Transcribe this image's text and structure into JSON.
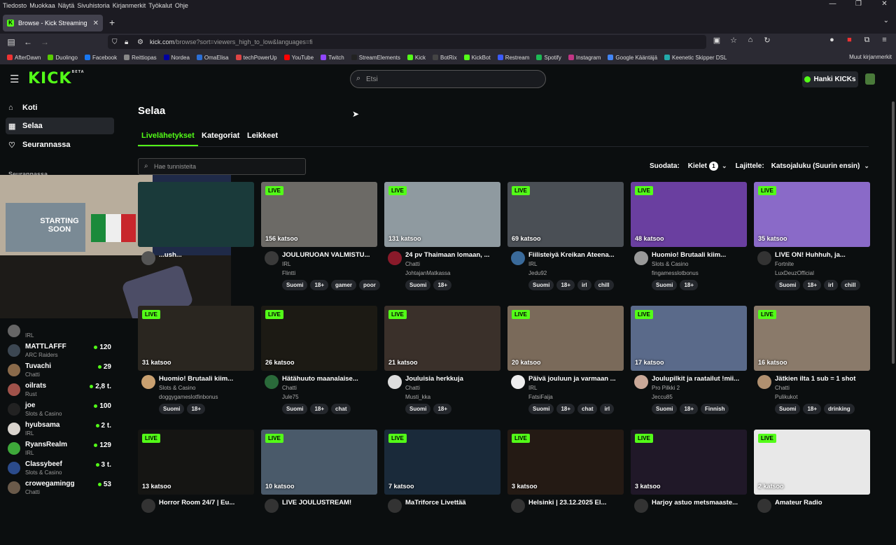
{
  "browser": {
    "menu": [
      "Tiedosto",
      "Muokkaa",
      "Näytä",
      "Sivuhistoria",
      "Kirjanmerkit",
      "Työkalut",
      "Ohje"
    ],
    "tab_title": "Browse - Kick Streaming",
    "url_domain": "kick.com",
    "url_path": "/browse?sort=viewers_high_to_low&languages=fi",
    "bookmarks": [
      {
        "label": "AfterDawn",
        "color": "#e33"
      },
      {
        "label": "Duolingo",
        "color": "#58cc02"
      },
      {
        "label": "Facebook",
        "color": "#1877f2"
      },
      {
        "label": "Reittiopas",
        "color": "#888"
      },
      {
        "label": "Nordea",
        "color": "#0000a0"
      },
      {
        "label": "OmaElisa",
        "color": "#2b6fd6"
      },
      {
        "label": "techPowerUp",
        "color": "#d44"
      },
      {
        "label": "YouTube",
        "color": "#f00"
      },
      {
        "label": "Twitch",
        "color": "#9146ff"
      },
      {
        "label": "StreamElements",
        "color": "#222"
      },
      {
        "label": "Kick",
        "color": "#53fc18"
      },
      {
        "label": "BotRix",
        "color": "#444"
      },
      {
        "label": "KickBot",
        "color": "#53fc18"
      },
      {
        "label": "Restream",
        "color": "#3b5bfd"
      },
      {
        "label": "Spotify",
        "color": "#1db954"
      },
      {
        "label": "Instagram",
        "color": "#c13584"
      },
      {
        "label": "Google Kääntäjä",
        "color": "#4285f4"
      },
      {
        "label": "Keenetic Skipper DSL",
        "color": "#2aa"
      }
    ],
    "other_bookmarks": "Muut kirjanmerkit"
  },
  "header": {
    "logo": "KICK",
    "logo_tag": "BETA",
    "search_placeholder": "Etsi",
    "kicks_button": "Hanki KICKs"
  },
  "sidebar": {
    "nav": [
      {
        "label": "Koti",
        "icon": "home-icon"
      },
      {
        "label": "Selaa",
        "icon": "browse-icon"
      },
      {
        "label": "Seurannassa",
        "icon": "heart-icon"
      }
    ],
    "following_title": "Seurannassa",
    "following": [
      {
        "name": "",
        "category": "IRL",
        "viewers": "",
        "color": "#666"
      },
      {
        "name": "MATTLAFFF",
        "category": "ARC Raiders",
        "viewers": "120",
        "color": "#3c4752"
      },
      {
        "name": "Tuvachi",
        "category": "Chatti",
        "viewers": "29",
        "color": "#8a6a4a"
      },
      {
        "name": "oilrats",
        "category": "Rust",
        "viewers": "2,8 t.",
        "color": "#a0524a"
      },
      {
        "name": "joe",
        "category": "Slots & Casino",
        "viewers": "100",
        "color": "#222"
      },
      {
        "name": "hyubsama",
        "category": "IRL",
        "viewers": "2 t.",
        "color": "#d9d4ce"
      },
      {
        "name": "RyansRealm",
        "category": "IRL",
        "viewers": "129",
        "color": "#3ea83a"
      },
      {
        "name": "Classybeef",
        "category": "Slots & Casino",
        "viewers": "3 t.",
        "color": "#2b4b8b"
      },
      {
        "name": "crowegamingg",
        "category": "Chatti",
        "viewers": "53",
        "color": "#6a5a4a"
      }
    ]
  },
  "webcam": {
    "poster_text": "STARTING SOON"
  },
  "main": {
    "title": "Selaa",
    "tabs": [
      "Livelähetykset",
      "Kategoriat",
      "Leikkeet"
    ],
    "tag_search_placeholder": "Hae tunnisteita",
    "filter_label": "Suodata:",
    "languages_label": "Kielet",
    "languages_count": "1",
    "sort_label": "Lajittele:",
    "sort_value": "Katsojaluku (Suurin ensin)",
    "live_label": "LIVE",
    "cards": [
      {
        "viewers": "",
        "title": "...ush...",
        "category": "",
        "name": "",
        "tags": [
          "",
          "",
          "",
          ""
        ],
        "thumb": "#1a3a3a",
        "avatar": "#555"
      },
      {
        "viewers": "156 katsoo",
        "title": "JOULURUOAN VALMISTU...",
        "category": "IRL",
        "name": "Flintti",
        "tags": [
          "Suomi",
          "18+",
          "gamer",
          "poor"
        ],
        "thumb": "#6c6a66",
        "avatar": "#3a3a3a"
      },
      {
        "viewers": "131 katsoo",
        "title": "24 pv Thaimaan lomaan, ...",
        "category": "Chatti",
        "name": "JohtajanMatkassa",
        "tags": [
          "Suomi",
          "18+",
          "",
          ""
        ],
        "thumb": "#8f9aa0",
        "avatar": "#8a1a2a"
      },
      {
        "viewers": "69 katsoo",
        "title": "Fiilisteiyä Kreikan Ateena...",
        "category": "IRL",
        "name": "Jedu92",
        "tags": [
          "Suomi",
          "18+",
          "irl",
          "chill"
        ],
        "thumb": "#4a4f55",
        "avatar": "#3a6a9a"
      },
      {
        "viewers": "48 katsoo",
        "title": "Huomio! Brutaali kiim...",
        "category": "Slots & Casino",
        "name": "fingamesslotbonus",
        "tags": [
          "Suomi",
          "18+",
          "",
          ""
        ],
        "thumb": "#6a3fa0",
        "avatar": "#999"
      },
      {
        "viewers": "35 katsoo",
        "title": "LIVE ON! Huhhuh, ja...",
        "category": "Fortnite",
        "name": "LuxDeuzOfficial",
        "tags": [
          "Suomi",
          "18+",
          "irl",
          "chill"
        ],
        "thumb": "#8a6ac8",
        "avatar": "#333"
      },
      {
        "viewers": "31 katsoo",
        "title": "Huomio! Brutaali kiim...",
        "category": "Slots & Casino",
        "name": "doggygameslotfinbonus",
        "tags": [
          "Suomi",
          "18+",
          "",
          ""
        ],
        "thumb": "#2a2620",
        "avatar": "#c9a070"
      },
      {
        "viewers": "26 katsoo",
        "title": "Hätähuuto maanalaise...",
        "category": "Chatti",
        "name": "Jule75",
        "tags": [
          "Suomi",
          "18+",
          "chat",
          ""
        ],
        "thumb": "#1c1a14",
        "avatar": "#2a6a3a"
      },
      {
        "viewers": "21 katsoo",
        "title": "Jouluisia herkkuja",
        "category": "Chatti",
        "name": "Musti_kka",
        "tags": [
          "Suomi",
          "18+",
          "",
          ""
        ],
        "thumb": "#3a302a",
        "avatar": "#ddd"
      },
      {
        "viewers": "20 katsoo",
        "title": "Päivä jouluun ja varmaan ...",
        "category": "IRL",
        "name": "FatsiFaija",
        "tags": [
          "Suomi",
          "18+",
          "chat",
          "irl"
        ],
        "thumb": "#7a6a5a",
        "avatar": "#eee"
      },
      {
        "viewers": "17 katsoo",
        "title": "Joulupilkit ja raatailut !mii...",
        "category": "Pro Pilkki 2",
        "name": "Jeccu85",
        "tags": [
          "Suomi",
          "18+",
          "Finnish",
          ""
        ],
        "thumb": "#5a6a8a",
        "avatar": "#c9a898"
      },
      {
        "viewers": "16 katsoo",
        "title": "Jätkien ilta 1 sub = 1 shot",
        "category": "Chatti",
        "name": "Pulikukot",
        "tags": [
          "Suomi",
          "18+",
          "drinking",
          ""
        ],
        "thumb": "#8a7a6a",
        "avatar": "#b09070"
      },
      {
        "viewers": "13 katsoo",
        "title": "Horror Room 24/7 | Eu...",
        "category": "",
        "name": "",
        "tags": [
          "",
          "",
          "",
          ""
        ],
        "thumb": "#151513",
        "avatar": "#333"
      },
      {
        "viewers": "10 katsoo",
        "title": "LIVE JOULUSTREAM!",
        "category": "",
        "name": "",
        "tags": [
          "",
          "",
          "",
          ""
        ],
        "thumb": "#4a5a6a",
        "avatar": "#333"
      },
      {
        "viewers": "7 katsoo",
        "title": "MaTriforce Livettää",
        "category": "",
        "name": "",
        "tags": [
          "",
          "",
          "",
          ""
        ],
        "thumb": "#1a2a3a",
        "avatar": "#333"
      },
      {
        "viewers": "3 katsoo",
        "title": "Helsinki | 23.12.2025 El...",
        "category": "",
        "name": "",
        "tags": [
          "",
          "",
          "",
          ""
        ],
        "thumb": "#241a14",
        "avatar": "#333"
      },
      {
        "viewers": "3 katsoo",
        "title": "Harjoy astuo metsmaaste...",
        "category": "",
        "name": "",
        "tags": [
          "",
          "",
          "",
          ""
        ],
        "thumb": "#201828",
        "avatar": "#333"
      },
      {
        "viewers": "2 katsoo",
        "title": "Amateur Radio",
        "category": "",
        "name": "",
        "tags": [
          "",
          "",
          "",
          ""
        ],
        "thumb": "#e8e8e8",
        "avatar": "#333"
      }
    ]
  }
}
